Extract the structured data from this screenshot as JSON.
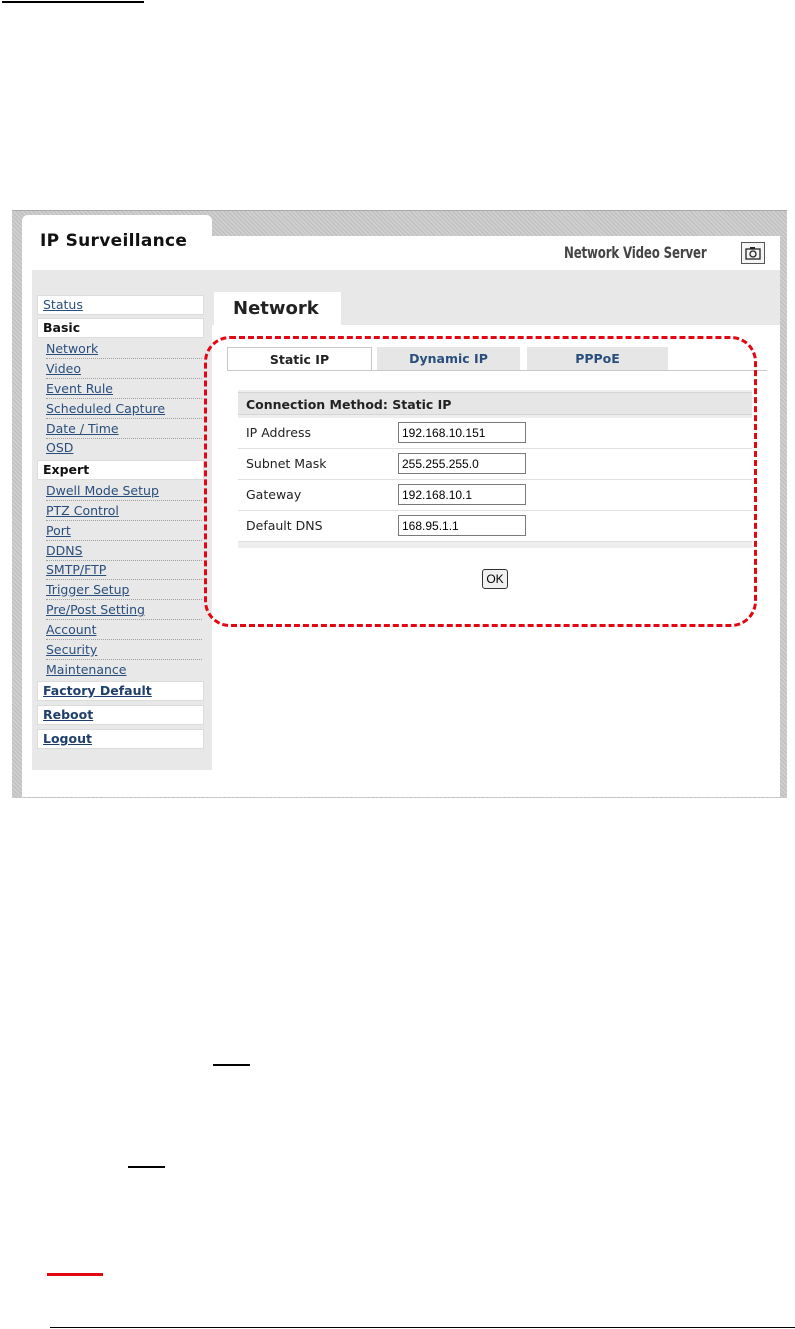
{
  "app": {
    "title": "IP Surveillance",
    "product_name": "Network Video Server",
    "snapshot_icon": "camera-icon"
  },
  "page": {
    "title": "Network"
  },
  "sidebar": {
    "status": "Status",
    "basic_header": "Basic",
    "basic_items": [
      "Network",
      "Video",
      "Event Rule",
      "Scheduled Capture",
      "Date / Time",
      "OSD"
    ],
    "expert_header": "Expert",
    "expert_items": [
      "Dwell Mode Setup",
      "PTZ Control",
      "Port",
      "DDNS",
      "SMTP/FTP",
      "Trigger Setup",
      "Pre/Post Setting",
      "Account",
      "Security",
      "Maintenance"
    ],
    "factory_default": "Factory Default",
    "reboot": "Reboot",
    "logout": "Logout"
  },
  "tabs": [
    {
      "label": "Static IP",
      "active": true
    },
    {
      "label": "Dynamic IP",
      "active": false
    },
    {
      "label": "PPPoE",
      "active": false
    }
  ],
  "form": {
    "header": "Connection Method: Static IP",
    "fields": [
      {
        "label": "IP Address",
        "value": "192.168.10.151"
      },
      {
        "label": "Subnet Mask",
        "value": "255.255.255.0"
      },
      {
        "label": "Gateway",
        "value": "192.168.10.1"
      },
      {
        "label": "Default DNS",
        "value": "168.95.1.1"
      }
    ],
    "ok_label": "OK"
  },
  "colors": {
    "annotation": "#e30613",
    "link": "#2a4e7c",
    "sidebar_bg": "#e8e8e8"
  }
}
